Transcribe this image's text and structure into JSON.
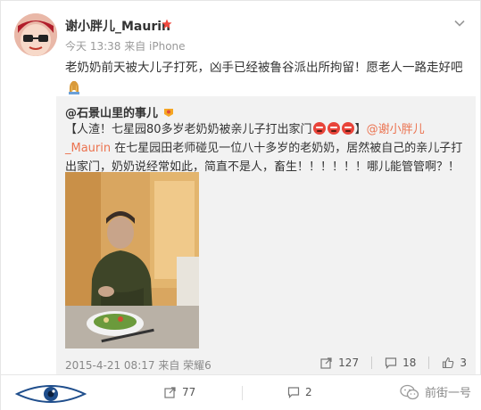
{
  "post": {
    "username": "谢小胖儿_Maurin",
    "meta": "今天 13:38 来自 iPhone",
    "text": "老奶奶前天被大儿子打死，凶手已经被鲁谷派出所拘留！愿老人一路走好吧"
  },
  "retweet": {
    "author": "@石景山里的事儿",
    "text_part1": "【人渣！七星园80多岁老奶奶被亲儿子打出家门",
    "text_part2": "】",
    "mention": "@谢小胖儿_Maurin",
    "text_part3": " 在七星园田老师碰见一位八十多岁的老奶奶，居然被自己的亲儿子打出家门，奶奶说经常如此，简直不是人，畜生！！！！！！哪儿能管管啊？！",
    "date": "2015-4-21 08:17 来自 荣耀6",
    "repost_count": "127",
    "comment_count": "18",
    "like_count": "3"
  },
  "footer": {
    "repost_count": "77",
    "comment_count": "2",
    "watermark": "前街一号"
  },
  "colors": {
    "accent": "#eb7350",
    "retweet_bg": "#f2f2f2",
    "muted": "#999999"
  },
  "icons": [
    "avatar",
    "vip-badge-icon",
    "chevron-down-icon",
    "praying-hands-icon",
    "angry-face-icon",
    "repost-icon",
    "comment-icon",
    "like-icon",
    "eye-logo",
    "wechat-icon"
  ]
}
